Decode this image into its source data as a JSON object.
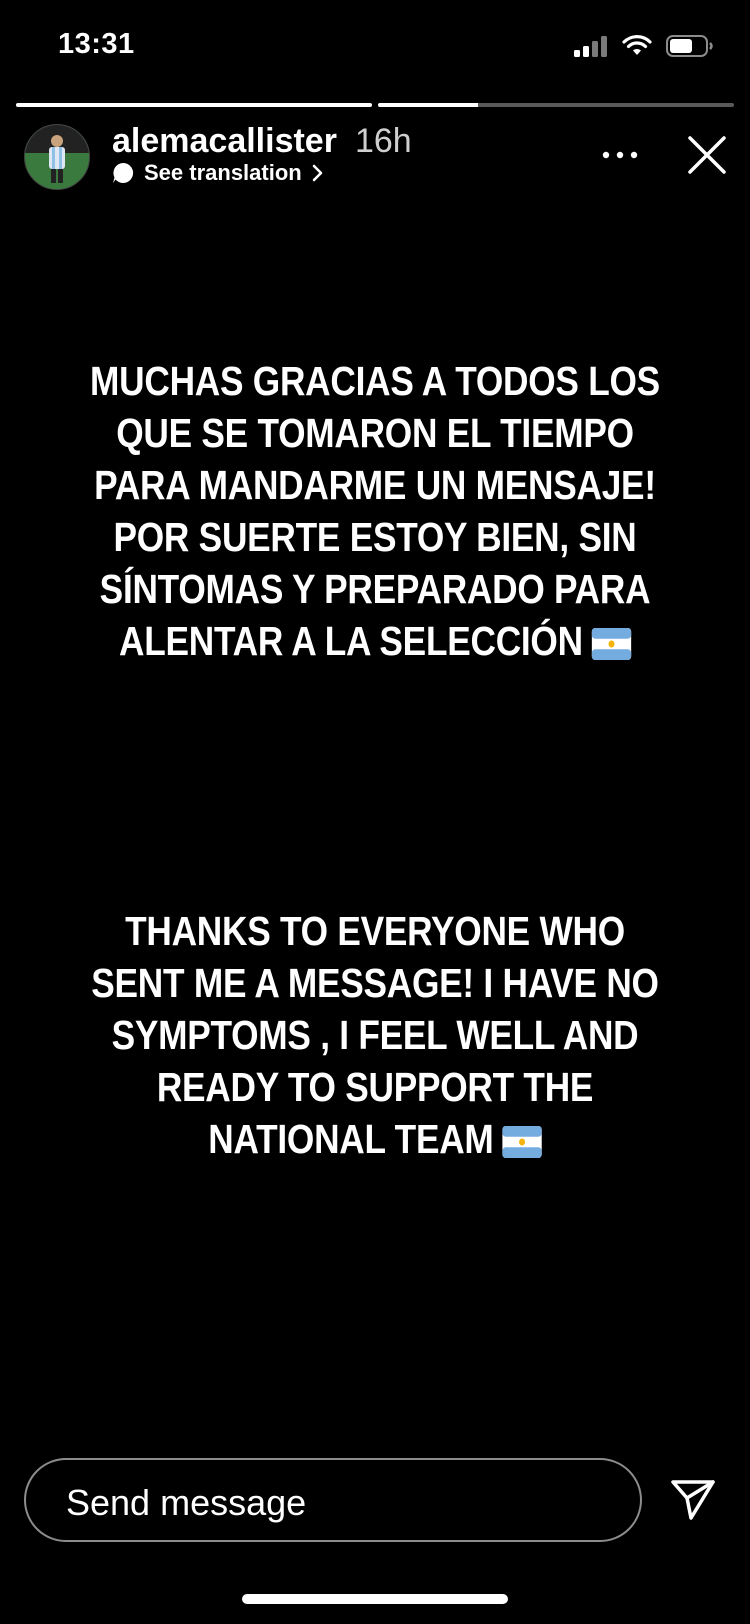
{
  "status_bar": {
    "time": "13:31",
    "signal_icon": "cellular-signal-icon",
    "wifi_icon": "wifi-icon",
    "battery_icon": "battery-icon"
  },
  "progress": {
    "segments": [
      {
        "state": "complete",
        "fill": 1.0
      },
      {
        "state": "current",
        "fill": 0.28
      }
    ]
  },
  "header": {
    "username": "alemacallister",
    "time_ago": "16h",
    "translation_label": "See translation",
    "translation_icon": "translate-bubble-icon",
    "translation_chevron": "chevron-right-icon",
    "more_icon": "more-dots-icon",
    "close_icon": "close-icon"
  },
  "story": {
    "spanish_text": "MUCHAS GRACIAS A TODOS LOS QUE SE TOMARON EL TIEMPO PARA MANDARME UN MENSAJE! POR SUERTE ESTOY BIEN, SIN SÍNTOMAS Y PREPARADO PARA ALENTAR A LA SELECCIÓN",
    "english_text": "THANKS TO EVERYONE WHO SENT ME A MESSAGE! I HAVE NO SYMPTOMS , I FEEL WELL AND READY TO SUPPORT THE NATIONAL TEAM",
    "emoji": "argentina-flag-icon"
  },
  "composer": {
    "placeholder": "Send message",
    "send_icon": "send-paper-plane-icon"
  },
  "colors": {
    "background": "#000000",
    "text": "#ffffff",
    "flag_blue": "#74acdf"
  }
}
